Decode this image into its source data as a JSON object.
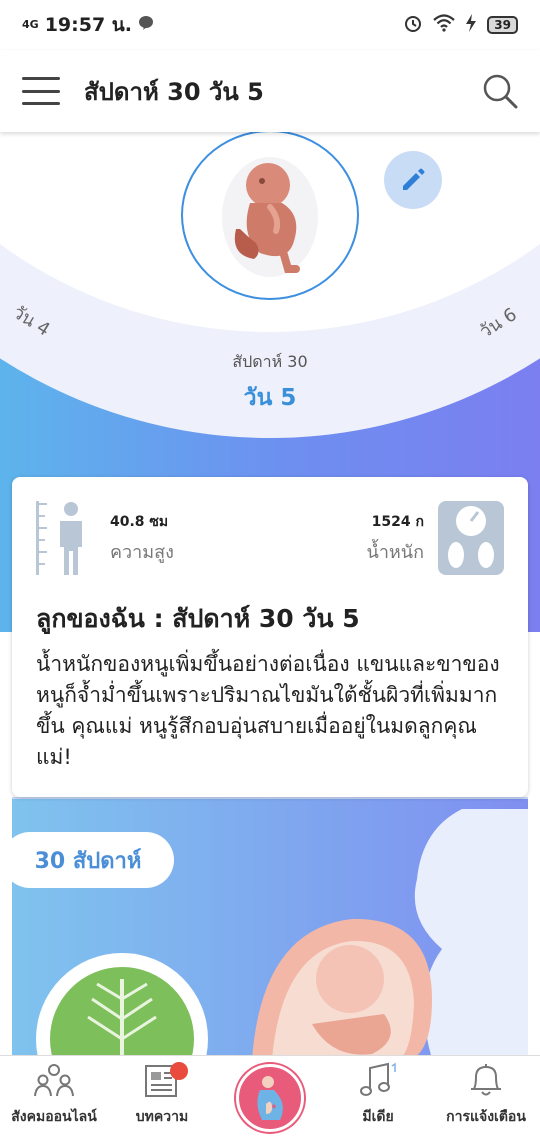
{
  "status_bar": {
    "network": "4G",
    "time": "19:57 น.",
    "battery": "39"
  },
  "app_bar": {
    "title": "สัปดาห์ 30 วัน 5"
  },
  "hero": {
    "prev_day": "วัน 4",
    "next_day": "วัน 6",
    "week_label": "สัปดาห์ 30",
    "current_day": "วัน 5"
  },
  "card": {
    "height_value": "40.8 ซม",
    "height_label": "ความสูง",
    "weight_value": "1524 ก",
    "weight_label": "น้ำหนัก",
    "title": "ลูกของฉัน : สัปดาห์ 30 วัน 5",
    "body": "น้ำหนักของหนูเพิ่มขึ้นอย่างต่อเนื่อง แขนและขาของหนูก็จ้ำม่ำขึ้นเพราะปริมาณไขมันใต้ชั้นผิวที่เพิ่มมากขึ้น คุณแม่ หนูรู้สึกอบอุ่นสบายเมื่ออยู่ในมดลูกคุณแม่!"
  },
  "banner": {
    "week_tag": "30 สัปดาห์"
  },
  "bottom_nav": {
    "items": [
      {
        "label": "สังคมออนไลน์",
        "icon": "community-icon"
      },
      {
        "label": "บทความ",
        "icon": "article-icon"
      },
      {
        "label": "",
        "icon": "pregnancy-icon"
      },
      {
        "label": "มีเดีย",
        "icon": "music-icon"
      },
      {
        "label": "การแจ้งเตือน",
        "icon": "bell-icon"
      }
    ]
  },
  "colors": {
    "accent": "#3a90d8",
    "hero_gradient_start": "#5db4ec",
    "hero_gradient_end": "#7b7ff0",
    "center_button": "#e95b7a",
    "badge": "#e94b3c"
  }
}
